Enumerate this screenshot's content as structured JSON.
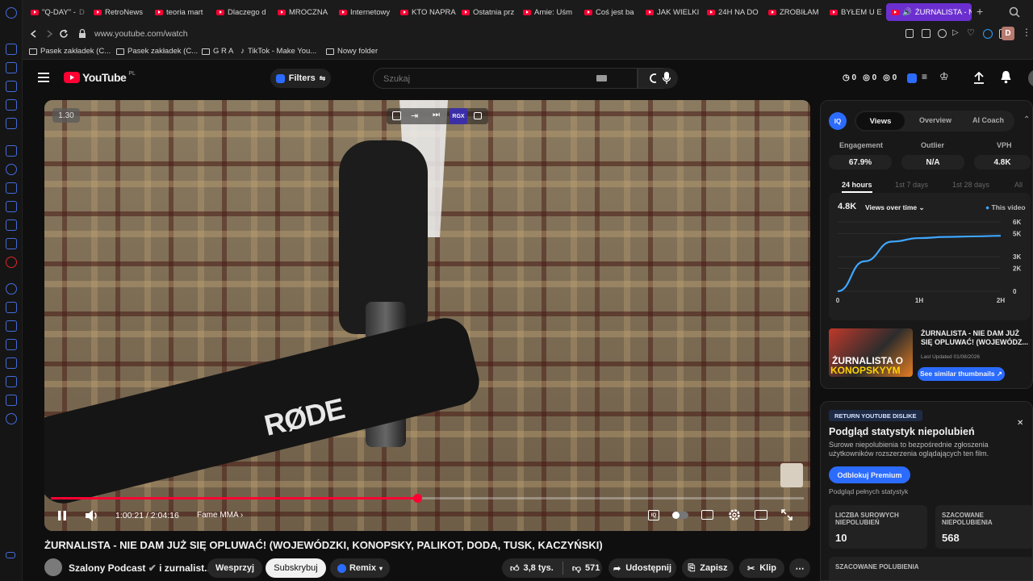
{
  "tabs": [
    {
      "label": "\"Q-DAY\" - ",
      "fade": "D"
    },
    {
      "label": "RetroNews",
      "fade": ""
    },
    {
      "label": "teoria mart",
      "fade": ""
    },
    {
      "label": "Dlaczego d",
      "fade": ""
    },
    {
      "label": "MROCZNA",
      "fade": ""
    },
    {
      "label": "Internetowy",
      "fade": ""
    },
    {
      "label": "KTO NAPRA",
      "fade": ""
    },
    {
      "label": "Ostatnia prz",
      "fade": ""
    },
    {
      "label": "Arnie: Uśm",
      "fade": ""
    },
    {
      "label": "Coś jest ba",
      "fade": ""
    },
    {
      "label": "JAK WIELKI",
      "fade": ""
    },
    {
      "label": "24H NA DO",
      "fade": ""
    },
    {
      "label": "ZROBIŁAM",
      "fade": ""
    },
    {
      "label": "BYŁEM U E",
      "fade": ""
    },
    {
      "label": "ŻURNALISTA - N",
      "fade": ""
    }
  ],
  "address": {
    "url": "www.youtube.com/watch",
    "profile_initial": "D"
  },
  "bookmarks": [
    {
      "label": "Pasek zakładek (C...",
      "icon": "folder-icon"
    },
    {
      "label": "Pasek zakładek (C...",
      "icon": "folder-icon"
    },
    {
      "label": "G R A",
      "icon": "folder-icon"
    },
    {
      "label": "TikTok - Make You...",
      "icon": "tiktok-icon"
    },
    {
      "label": "Nowy folder",
      "icon": "folder-icon"
    }
  ],
  "header": {
    "logo_text": "YouTube",
    "country": "PL",
    "filters_label": "Filters",
    "search_placeholder": "Szukaj",
    "counters": [
      "0",
      "0",
      "0"
    ]
  },
  "video": {
    "speed_badge": "1.30",
    "top_badge": "RGX",
    "time": "1:00:21 / 2:04:16",
    "chapter": "Fame MMA",
    "progress": 0.487
  },
  "title": "ŻURNALISTA - NIE DAM JUŻ SIĘ OPLUWAĆ! (WOJEWÓDZKI, KONOPSKY, PALIKOT, DODA, TUSK, KACZYŃSKI)",
  "channel": {
    "name": "Szalony Podcast",
    "collab": "i zurnalist...",
    "support": "Wesprzyj",
    "subscribe": "Subskrybuj",
    "remix": "Remix"
  },
  "actions": {
    "likes": "3,8 tys.",
    "dislikes": "571",
    "share": "Udostępnij",
    "save": "Zapisz",
    "clip": "Klip"
  },
  "side_panel": {
    "badge": "IQ",
    "tabs": [
      "Views",
      "Overview",
      "AI Coach"
    ],
    "stats": [
      {
        "label": "Engagement",
        "value": "67.9%"
      },
      {
        "label": "Outlier",
        "value": "N/A"
      },
      {
        "label": "VPH",
        "value": "4.8K"
      }
    ],
    "ranges": [
      "24 hours",
      "1st 7 days",
      "1st 28 days",
      "All"
    ],
    "views_value": "4.8K",
    "views_label": "Views over time",
    "legend": "This video",
    "thumb_title": "ŻURNALISTA - NIE DAM JUŻ SIĘ OPLUWAĆ! (WOJEWÓDZ...",
    "last_updated": "Last Updated 01/08/2026",
    "thumb_overlay_1": "ŻURNALISTA O",
    "thumb_overlay_2": "KONOPSKYYM",
    "similar_btn": "See similar thumbnails ↗"
  },
  "chart_data": {
    "type": "line",
    "title": "Views over time",
    "x": [
      "0",
      "1H",
      "2H"
    ],
    "x_values": [
      0,
      0.33,
      0.67,
      1.0,
      1.33,
      1.67,
      2.0
    ],
    "series": [
      {
        "name": "This video",
        "values": [
          0,
          2600,
          4300,
          4600,
          4700,
          4750,
          4800
        ]
      }
    ],
    "y_ticks": [
      "6K",
      "5K",
      "3K",
      "2K",
      "0"
    ],
    "ylim": [
      0,
      6000
    ],
    "color": "#3ea6ff"
  },
  "dislike_panel": {
    "tag": "RETURN YOUTUBE DISLIKE",
    "heading": "Podgląd statystyk niepolubień",
    "desc": "Surowe niepolubienia to bezpośrednie zgłoszenia użytkowników rozszerzenia oglądających ten film.",
    "premium_btn": "Odblokuj Premium",
    "preview_note": "Podgląd pełnych statystyk",
    "box1_label": "LICZBA SUROWYCH NIEPOLUBIEŃ",
    "box1_value": "10",
    "box2_label": "SZACOWANE NIEPOLUBIENIA",
    "box2_value": "568",
    "box3_label": "SZACOWANE POLUBIENIA"
  },
  "colors": {
    "accent": "#6b2fd0",
    "yt_red": "#ff0033",
    "iq_blue": "#2b6cff",
    "progress": "#ff0033"
  }
}
